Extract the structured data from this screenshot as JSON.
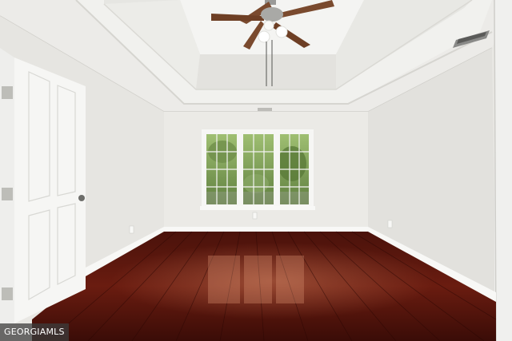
{
  "watermark": {
    "text": "GEORGIAMLS"
  },
  "colors": {
    "wall_left": "#e7e6e2",
    "wall_back": "#ebebe7",
    "wall_right": "#e4e3df",
    "ceiling": "#efefec",
    "tray_inner": "#f3f3f1",
    "floor_dark": "#3a0d08",
    "floor_mid": "#6b1a10",
    "floor_light": "#9a3a22",
    "baseboard": "#f7f7f5",
    "door": "#f6f6f4",
    "fan_blade": "#7a4a2e",
    "window_glass": "#7fa05a"
  }
}
